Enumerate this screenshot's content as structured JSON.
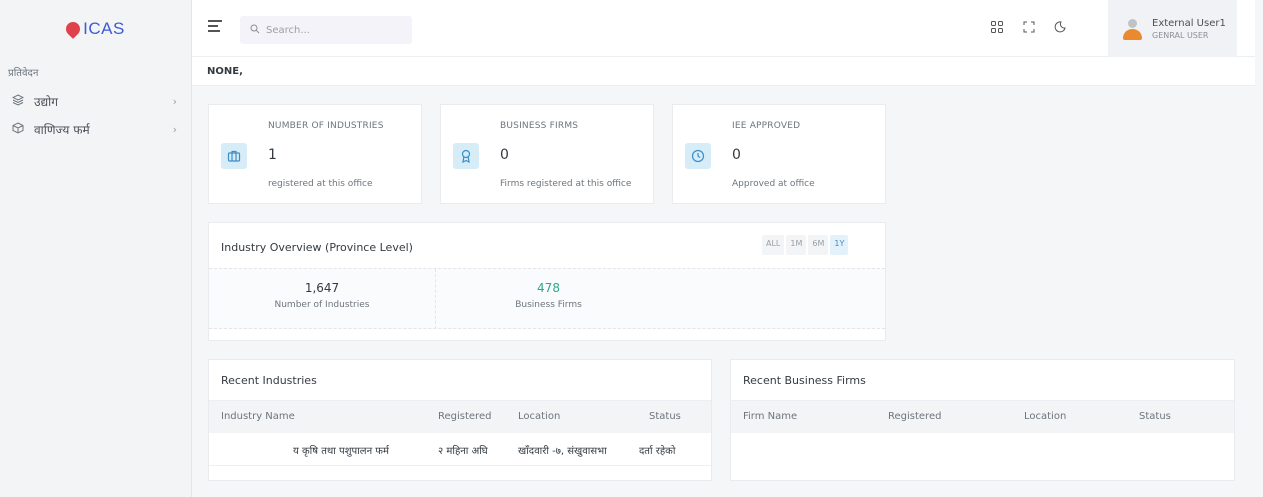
{
  "app": {
    "name": "ICAS"
  },
  "sidebar": {
    "section_title": "प्रतिवेदन",
    "items": [
      {
        "label": "उद्योग",
        "icon": "layers-icon"
      },
      {
        "label": "वाणिज्य फर्म",
        "icon": "box-icon"
      }
    ]
  },
  "topbar": {
    "search_placeholder": "Search...",
    "user": {
      "name": "External User1",
      "role": "GENRAL USER"
    }
  },
  "subheader": {
    "title": "NONE,"
  },
  "stats": [
    {
      "title": "NUMBER OF INDUSTRIES",
      "value": "1",
      "subtitle": "registered at this office",
      "icon": "briefcase-icon"
    },
    {
      "title": "BUSINESS FIRMS",
      "value": "0",
      "subtitle": "Firms registered at this office",
      "icon": "award-icon"
    },
    {
      "title": "IEE APPROVED",
      "value": "0",
      "subtitle": "Approved at office",
      "icon": "clock-icon"
    }
  ],
  "overview": {
    "title": "Industry Overview (Province Level)",
    "tabs": [
      "ALL",
      "1M",
      "6M",
      "1Y"
    ],
    "active_tab": "1Y",
    "metrics": [
      {
        "value": "1,647",
        "label": "Number of Industries"
      },
      {
        "value": "478",
        "label": "Business Firms"
      }
    ]
  },
  "recent_industries": {
    "title": "Recent Industries",
    "columns": [
      "Industry Name",
      "Registered",
      "Location",
      "Status"
    ],
    "rows": [
      [
        "य कृषि तथा पशुपालन फर्म",
        "२ महिना अघि",
        "खाँदवारी -७, संखुवासभा",
        "दर्ता रहेको"
      ]
    ]
  },
  "recent_firms": {
    "title": "Recent Business Firms",
    "columns": [
      "Firm Name",
      "Registered",
      "Location",
      "Status"
    ],
    "rows": []
  },
  "colors": {
    "brand": "#3d5bd6",
    "accent": "#3a8fc9",
    "green": "#2fa88b",
    "avatar": "#e98a2f"
  }
}
